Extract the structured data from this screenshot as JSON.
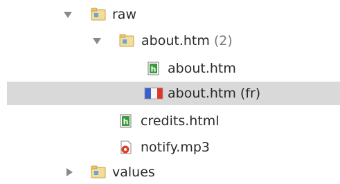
{
  "tree": {
    "items": [
      {
        "label": "raw",
        "icon": "folder-icon",
        "expanded": true
      },
      {
        "label": "about.htm",
        "count": "(2)",
        "icon": "folder-icon",
        "expanded": true
      },
      {
        "label": "about.htm",
        "icon": "html-file-icon"
      },
      {
        "label": "about.htm (fr)",
        "icon": "french-flag-icon",
        "selected": true
      },
      {
        "label": "credits.html",
        "icon": "html-file-icon"
      },
      {
        "label": "notify.mp3",
        "icon": "audio-file-icon"
      },
      {
        "label": "values",
        "icon": "folder-icon",
        "expanded": false
      }
    ]
  },
  "colors": {
    "selection": "#d9d9d9",
    "folder": "#e9c46a",
    "html_file": "#3a9a3a",
    "flag_blue": "#3a5fcd",
    "flag_red": "#e0352b",
    "audio": "#e0402a"
  }
}
